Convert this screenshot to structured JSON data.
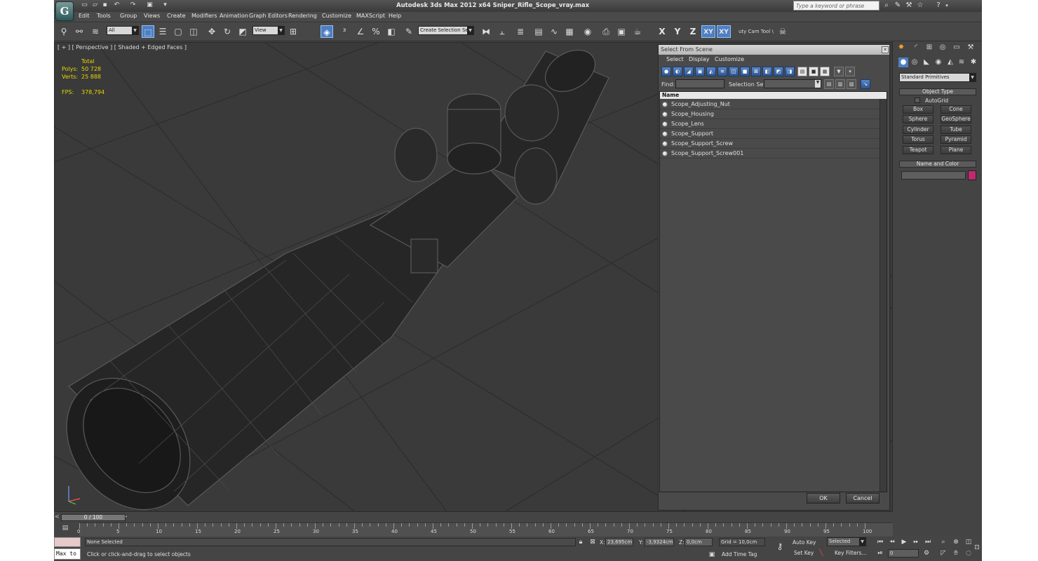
{
  "titlebar": {
    "title": "Autodesk 3ds Max  2012 x64      Sniper_Rifle_Scope_vray.max",
    "search_placeholder": "Type a keyword or phrase",
    "logo": "G"
  },
  "menu": [
    "Edit",
    "Tools",
    "Group",
    "Views",
    "Create",
    "Modifiers",
    "Animation",
    "Graph Editors",
    "Rendering",
    "Customize",
    "MAXScript",
    "Help"
  ],
  "toolbar": {
    "selection_filter": "All",
    "ref_coord": "View",
    "named_selection": "Create Selection Se",
    "axes": [
      "X",
      "Y",
      "Z",
      "XY",
      "XY"
    ],
    "cam_tool_label": "uty Cam Tool \\"
  },
  "viewport": {
    "label": "[ + ] [ Perspective ] [ Shaded + Edged Faces ]",
    "stats": {
      "total_label": "Total",
      "polys_label": "Polys:",
      "polys_value": "50 728",
      "verts_label": "Verts:",
      "verts_value": "25 888",
      "fps_label": "FPS:",
      "fps_value": "378,794"
    }
  },
  "dialog": {
    "title": "Select From Scene",
    "menu": [
      "Select",
      "Display",
      "Customize"
    ],
    "find_label": "Find:",
    "selection_set_label": "Selection Set:",
    "column_name": "Name",
    "objects": [
      "Scope_Adjusting_Nut",
      "Scope_Housing",
      "Scope_Lens",
      "Scope_Support",
      "Scope_Support_Screw",
      "Scope_Support_Screw001"
    ],
    "ok": "OK",
    "cancel": "Cancel"
  },
  "command_panel": {
    "category": "Standard Primitives",
    "object_type_title": "Object Type",
    "autogrid_label": "AutoGrid",
    "primitives": [
      "Box",
      "Cone",
      "Sphere",
      "GeoSphere",
      "Cylinder",
      "Tube",
      "Torus",
      "Pyramid",
      "Teapot",
      "Plane"
    ],
    "name_color_title": "Name and Color",
    "swatch_color": "#c2286e"
  },
  "timeline": {
    "slider_label": "0 / 100",
    "ticks": [
      0,
      5,
      10,
      15,
      20,
      25,
      30,
      35,
      40,
      45,
      50,
      55,
      60,
      65,
      70,
      75,
      80,
      85,
      90,
      95,
      100
    ]
  },
  "status": {
    "selection": "None Selected",
    "prompt": "Click or click-and-drag to select objects",
    "maxscript": "Max to",
    "x_label": "X:",
    "x_value": "23,695cm",
    "y_label": "Y:",
    "y_value": "-3,9324cm",
    "z_label": "Z:",
    "z_value": "0,0cm",
    "grid": "Grid = 10,0cm",
    "add_time_tag": "Add Time Tag",
    "auto_key": "Auto Key",
    "set_key": "Set Key",
    "key_mode": "Selected",
    "key_filters": "Key Filters...",
    "frame": "0"
  }
}
